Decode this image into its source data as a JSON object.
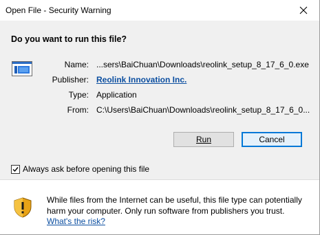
{
  "window": {
    "title": "Open File - Security Warning"
  },
  "question": "Do you want to run this file?",
  "details": {
    "name_label": "Name:",
    "name_value": "...sers\\BaiChuan\\Downloads\\reolink_setup_8_17_6_0.exe",
    "publisher_label": "Publisher:",
    "publisher_value": "Reolink Innovation Inc.",
    "type_label": "Type:",
    "type_value": "Application",
    "from_label": "From:",
    "from_value": "C:\\Users\\BaiChuan\\Downloads\\reolink_setup_8_17_6_0..."
  },
  "buttons": {
    "run_label": "Run",
    "cancel_label": "Cancel"
  },
  "checkbox": {
    "label": "Always ask before opening this file",
    "checked": true
  },
  "warning": {
    "text": "While files from the Internet can be useful, this file type can potentially harm your computer. Only run software from publishers you trust.",
    "link": "What's the risk?"
  },
  "icons": {
    "close": "close-icon",
    "file": "application-icon",
    "shield": "security-shield-icon",
    "check": "checkmark-icon"
  },
  "colors": {
    "link": "#0b4ea0",
    "accent": "#0078d7",
    "panel": "#f0f0f0"
  }
}
